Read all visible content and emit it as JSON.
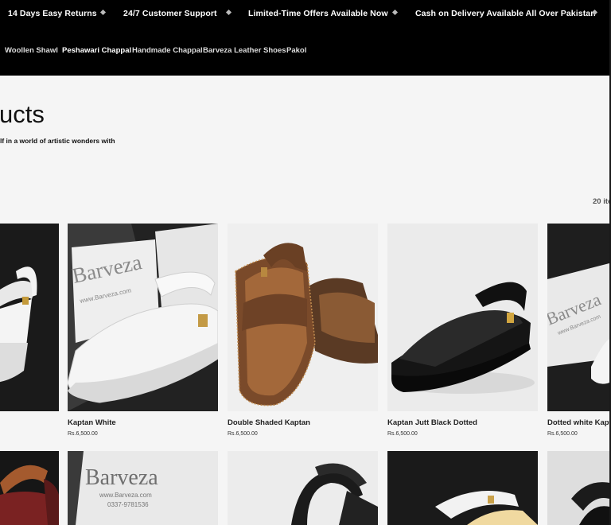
{
  "announcements": [
    "14 Days Easy Returns",
    "24/7 Customer Support",
    "Limited-Time Offers Available Now",
    "Cash on Delivery Available All Over Pakistan"
  ],
  "nav": {
    "items": [
      {
        "label": "Woollen Shawl"
      },
      {
        "label": "Peshawari Chappal"
      },
      {
        "label": "Handmade Chappal"
      },
      {
        "label": "Barveza Leather Shoes"
      },
      {
        "label": "Pakol"
      }
    ]
  },
  "collection": {
    "title": "ucts",
    "subtitle": "lf in a world of artistic wonders with",
    "count": "20 ite"
  },
  "products": [
    {
      "name": "Kaptan White",
      "price": "Rs.6,500.00",
      "brand": "Barveza",
      "site": "www.Barveza.com"
    },
    {
      "name": "Double Shaded Kaptan",
      "price": "Rs.6,500.00"
    },
    {
      "name": "Kaptan Jutt Black Dotted",
      "price": "Rs.6,500.00"
    },
    {
      "name": "Dotted white Kaptan",
      "price": "Rs.6,500.00",
      "brand": "Barveza",
      "site": "www.Barveza.com"
    }
  ],
  "row2": {
    "brand": "Barveza",
    "site": "www.Barveza.com",
    "phone": "0337-9781536"
  },
  "colors": {
    "header_bg": "#000000",
    "page_bg": "#f5f5f5"
  }
}
